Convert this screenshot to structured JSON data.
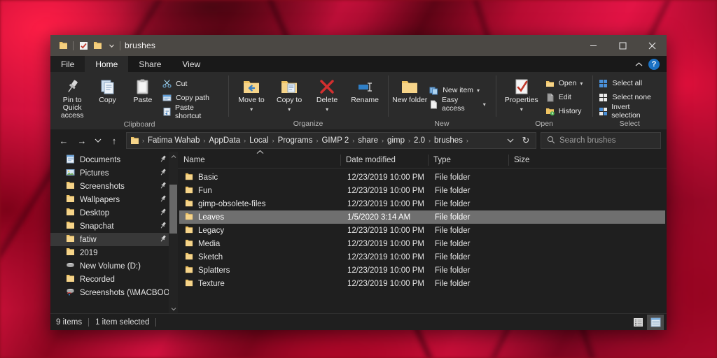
{
  "window": {
    "title": "brushes",
    "quick_access": [
      "folder-icon",
      "properties-icon",
      "new-folder-icon",
      "customize-dropdown-icon"
    ],
    "controls": {
      "minimize": "─",
      "maximize": "□",
      "close": "✕"
    }
  },
  "tabs": [
    {
      "id": "file",
      "label": "File"
    },
    {
      "id": "home",
      "label": "Home"
    },
    {
      "id": "share",
      "label": "Share"
    },
    {
      "id": "view",
      "label": "View"
    }
  ],
  "active_tab": "Home",
  "ribbon_right": {
    "collapse": "⌃",
    "help": "?"
  },
  "ribbon": {
    "groups": [
      {
        "name": "Clipboard",
        "big": [
          {
            "label": "Pin to Quick access",
            "icon": "pin-icon"
          },
          {
            "label": "Copy",
            "icon": "copy-icon"
          },
          {
            "label": "Paste",
            "icon": "paste-icon"
          }
        ],
        "small": [
          {
            "label": "Cut",
            "icon": "scissors-icon"
          },
          {
            "label": "Copy path",
            "icon": "copy-path-icon"
          },
          {
            "label": "Paste shortcut",
            "icon": "paste-shortcut-icon"
          }
        ]
      },
      {
        "name": "Organize",
        "big": [
          {
            "label": "Move to",
            "icon": "move-to-icon",
            "caret": "▾"
          },
          {
            "label": "Copy to",
            "icon": "copy-to-icon",
            "caret": "▾"
          },
          {
            "label": "Delete",
            "icon": "delete-icon",
            "caret": "▾"
          },
          {
            "label": "Rename",
            "icon": "rename-icon"
          }
        ],
        "small": []
      },
      {
        "name": "New",
        "big": [
          {
            "label": "New folder",
            "icon": "new-folder-icon"
          }
        ],
        "small": [
          {
            "label": "New item",
            "icon": "new-item-icon",
            "caret": "▾"
          },
          {
            "label": "Easy access",
            "icon": "easy-access-icon",
            "caret": "▾"
          }
        ]
      },
      {
        "name": "Open",
        "big": [
          {
            "label": "Properties",
            "icon": "properties-icon",
            "caret": "▾"
          }
        ],
        "small": [
          {
            "label": "Open",
            "icon": "open-icon",
            "caret": "▾"
          },
          {
            "label": "Edit",
            "icon": "edit-icon"
          },
          {
            "label": "History",
            "icon": "history-icon"
          }
        ]
      },
      {
        "name": "Select",
        "big": [],
        "small": [
          {
            "label": "Select all",
            "icon": "select-all-icon"
          },
          {
            "label": "Select none",
            "icon": "select-none-icon"
          },
          {
            "label": "Invert selection",
            "icon": "invert-selection-icon"
          }
        ]
      }
    ]
  },
  "navigation": {
    "back": "←",
    "forward": "→",
    "recent": "▾",
    "up": "↑",
    "breadcrumbs": [
      "Fatima Wahab",
      "AppData",
      "Local",
      "Programs",
      "GIMP 2",
      "share",
      "gimp",
      "2.0",
      "brushes"
    ],
    "separator": "›",
    "address_dropdown": "▾",
    "refresh": "↻"
  },
  "search": {
    "placeholder": "Search brushes",
    "icon": "search-icon"
  },
  "sidebar": {
    "items": [
      {
        "label": "Documents",
        "icon": "documents-icon",
        "pinned": true
      },
      {
        "label": "Pictures",
        "icon": "pictures-icon",
        "pinned": true
      },
      {
        "label": "Screenshots",
        "icon": "folder-icon",
        "pinned": true
      },
      {
        "label": "Wallpapers",
        "icon": "folder-icon",
        "pinned": true
      },
      {
        "label": "Desktop",
        "icon": "folder-icon",
        "pinned": true
      },
      {
        "label": "Snapchat",
        "icon": "folder-icon",
        "pinned": true
      },
      {
        "label": "fatiw",
        "icon": "folder-icon",
        "pinned": true,
        "selected": true
      },
      {
        "label": "2019",
        "icon": "folder-icon",
        "pinned": false
      },
      {
        "label": "New Volume (D:)",
        "icon": "drive-icon",
        "pinned": false
      },
      {
        "label": "Recorded",
        "icon": "folder-icon",
        "pinned": false
      },
      {
        "label": "Screenshots (\\\\MACBOOKA",
        "icon": "network-drive-icon",
        "pinned": false
      }
    ],
    "scroll_up": "⌃",
    "scroll_down": "⌄",
    "pin_glyph": "📌"
  },
  "filelist": {
    "columns": [
      "Name",
      "Date modified",
      "Type",
      "Size"
    ],
    "sort_column": "Name",
    "sort_direction": "ascending",
    "sort_glyph": "⌃",
    "rows": [
      {
        "name": "Basic",
        "date": "12/23/2019 10:00 PM",
        "type": "File folder",
        "size": "",
        "selected": false
      },
      {
        "name": "Fun",
        "date": "12/23/2019 10:00 PM",
        "type": "File folder",
        "size": "",
        "selected": false
      },
      {
        "name": "gimp-obsolete-files",
        "date": "12/23/2019 10:00 PM",
        "type": "File folder",
        "size": "",
        "selected": false
      },
      {
        "name": "Leaves",
        "date": "1/5/2020 3:14 AM",
        "type": "File folder",
        "size": "",
        "selected": true
      },
      {
        "name": "Legacy",
        "date": "12/23/2019 10:00 PM",
        "type": "File folder",
        "size": "",
        "selected": false
      },
      {
        "name": "Media",
        "date": "12/23/2019 10:00 PM",
        "type": "File folder",
        "size": "",
        "selected": false
      },
      {
        "name": "Sketch",
        "date": "12/23/2019 10:00 PM",
        "type": "File folder",
        "size": "",
        "selected": false
      },
      {
        "name": "Splatters",
        "date": "12/23/2019 10:00 PM",
        "type": "File folder",
        "size": "",
        "selected": false
      },
      {
        "name": "Texture",
        "date": "12/23/2019 10:00 PM",
        "type": "File folder",
        "size": "",
        "selected": false
      }
    ]
  },
  "statusbar": {
    "item_count": "9 items",
    "selection": "1 item selected",
    "views": [
      {
        "name": "details-view",
        "active": false
      },
      {
        "name": "large-icons-view",
        "active": true
      }
    ]
  },
  "colors": {
    "titlebar": "#4b4844",
    "ribbon": "#2b2b2b",
    "window_bg": "#1f1f1f",
    "selection": "#6f6f6f",
    "folder_yellow": "#f5c96a",
    "help_blue": "#1b72c4",
    "accent_red": "#d32f3c"
  }
}
